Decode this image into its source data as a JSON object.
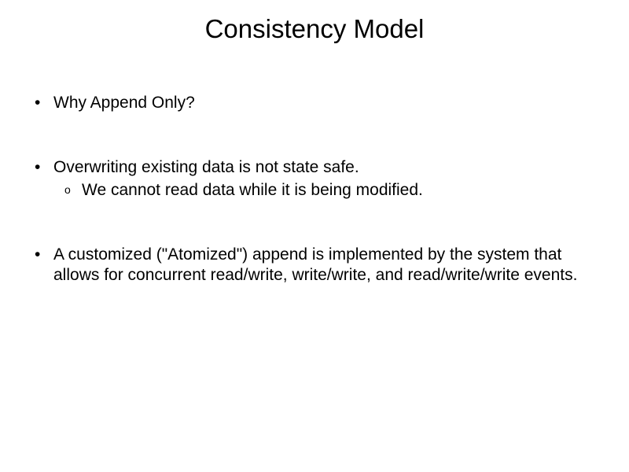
{
  "slide": {
    "title": "Consistency Model",
    "bullets": [
      {
        "text": "Why Append Only?",
        "sub": []
      },
      {
        "text": "Overwriting existing data is not state safe.",
        "sub": [
          "We cannot read data while it is being modified."
        ]
      },
      {
        "text": "A customized (\"Atomized\") append is implemented by the system that allows for concurrent read/write, write/write, and read/write/write events.",
        "sub": []
      }
    ]
  }
}
